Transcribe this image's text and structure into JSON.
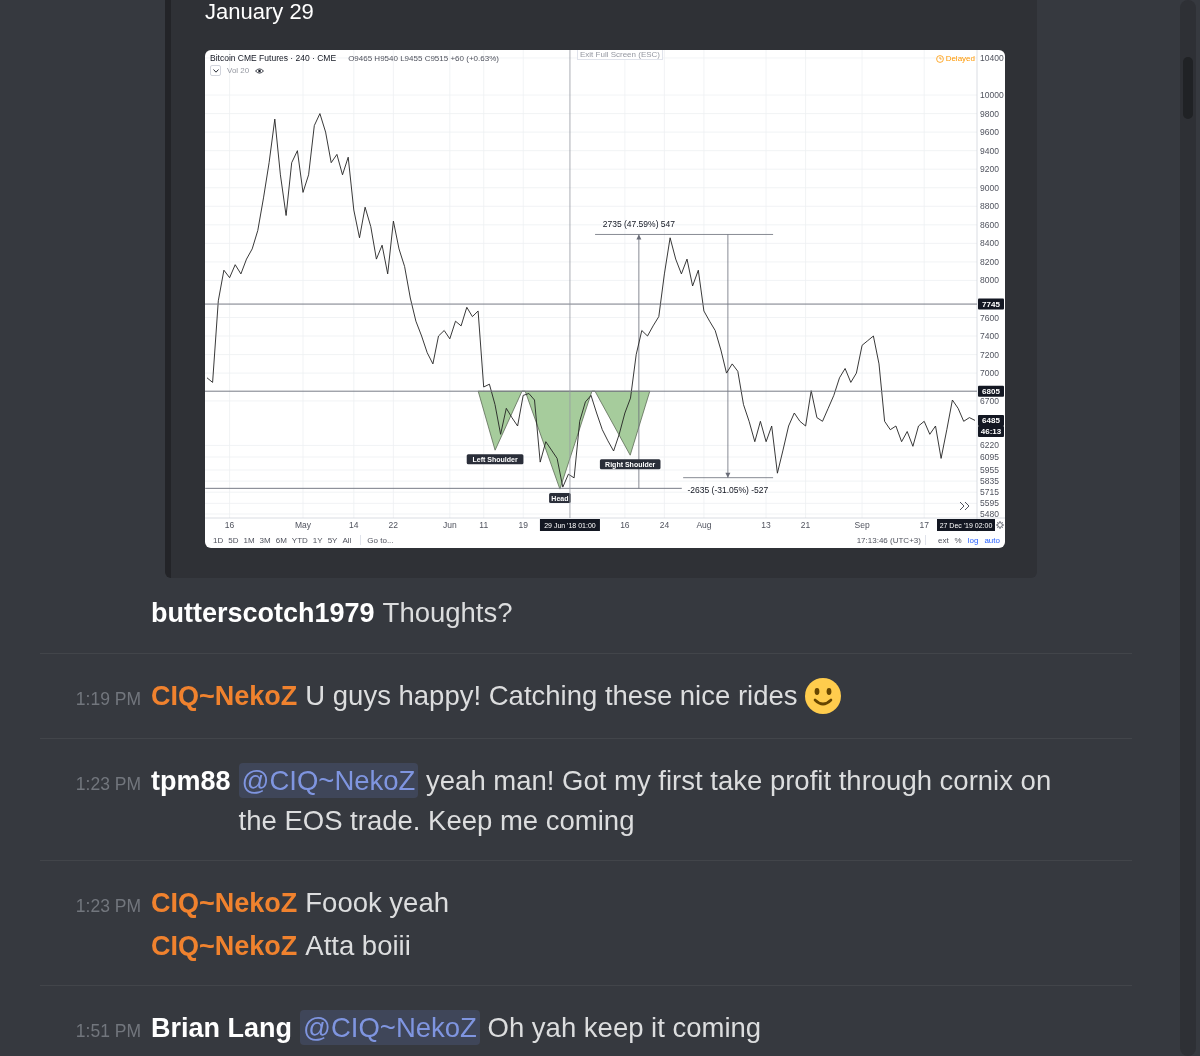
{
  "embed": {
    "title": "January 29",
    "image": {
      "ohlc": "O9465 H9540 L9455 C9515 +60 (+0.63%)",
      "indicator": "Vol 20",
      "exit_hint": "Exit Full Screen (ESC)",
      "status": "Delayed",
      "chart_data": {
        "type": "line",
        "title": "Bitcoin CME Futures · 240 · CME",
        "grid": true,
        "ylim": [
          5437,
          10486
        ],
        "categories": [
          null,
          null,
          null,
          null,
          "16",
          null,
          null,
          null,
          null,
          null,
          null,
          null,
          null,
          null,
          null,
          null,
          null,
          "May",
          null,
          null,
          null,
          null,
          null,
          null,
          null,
          null,
          "14",
          null,
          null,
          null,
          null,
          null,
          null,
          "22",
          null,
          null,
          null,
          null,
          null,
          null,
          null,
          null,
          null,
          "Jun",
          null,
          null,
          null,
          null,
          null,
          "11",
          null,
          null,
          null,
          null,
          null,
          null,
          "19",
          null,
          null,
          null,
          null,
          null,
          null,
          null,
          null,
          null,
          null,
          null,
          null,
          null,
          null,
          null,
          null,
          null,
          "16",
          null,
          null,
          null,
          null,
          null,
          null,
          "24",
          null,
          null,
          null,
          null,
          null,
          null,
          "Aug",
          null,
          null,
          null,
          null,
          null,
          null,
          null,
          null,
          null,
          null,
          "13",
          null,
          null,
          null,
          null,
          null,
          null,
          "21",
          null,
          null,
          null,
          null,
          null,
          null,
          null,
          null,
          null,
          "Sep",
          null,
          null,
          null,
          null,
          null,
          null,
          null,
          null,
          null,
          null,
          "17",
          null,
          null,
          null,
          null,
          null,
          null,
          null,
          null,
          null
        ],
        "yticks": [
          10400,
          10000,
          9800,
          9600,
          9400,
          9200,
          9000,
          8800,
          8600,
          8400,
          8200,
          8000,
          7600,
          7400,
          7200,
          7000,
          6700,
          6220,
          6095,
          5955,
          5835,
          5715,
          5595,
          5480
        ],
        "values": [
          6950,
          6900,
          7780,
          8110,
          8030,
          8170,
          8070,
          8230,
          8340,
          8540,
          8890,
          9270,
          9740,
          9140,
          8700,
          9270,
          9400,
          8950,
          9140,
          9670,
          9800,
          9600,
          9270,
          9360,
          9140,
          9330,
          8760,
          8460,
          8790,
          8580,
          8230,
          8380,
          8070,
          8640,
          8340,
          8150,
          7810,
          7560,
          7400,
          7220,
          7100,
          7400,
          7460,
          7370,
          7560,
          7510,
          7710,
          7610,
          7670,
          6850,
          6880,
          6660,
          6340,
          6620,
          6520,
          6430,
          6760,
          6780,
          6710,
          6040,
          6260,
          6170,
          6080,
          5770,
          5910,
          5870,
          6480,
          6690,
          6760,
          6570,
          6390,
          6270,
          6160,
          6340,
          6570,
          6730,
          7200,
          7460,
          7400,
          7510,
          7610,
          8070,
          8460,
          8230,
          8070,
          8230,
          7940,
          8110,
          7670,
          7560,
          7460,
          7250,
          7000,
          7100,
          7020,
          6660,
          6480,
          6260,
          6480,
          6260,
          6430,
          5920,
          6170,
          6430,
          6570,
          6480,
          6430,
          6810,
          6520,
          6480,
          6620,
          6760,
          6950,
          7050,
          6900,
          7000,
          7300,
          7350,
          7400,
          7100,
          6480,
          6390,
          6430,
          6260,
          6370,
          6210,
          6430,
          6480,
          6340,
          6430,
          6080,
          6390,
          6710,
          6620,
          6480,
          6520,
          6490
        ],
        "ref_lines": [
          {
            "axis": "y",
            "value": 7745,
            "label": "7745"
          },
          {
            "axis": "y",
            "value": 6805,
            "label": "6805"
          }
        ],
        "annotations": [
          "Left Shoulder",
          "Head",
          "Right Shoulder",
          "2735 (47.59%) 547",
          "-2635 (-31.05%) -527",
          "6485",
          "46:13",
          "29 Jun '18 01:00",
          "27 Dec '19 02:00"
        ]
      },
      "ranges": [
        {
          "label": "1D",
          "selected": false
        },
        {
          "label": "5D",
          "selected": false
        },
        {
          "label": "1M",
          "selected": false
        },
        {
          "label": "3M",
          "selected": false
        },
        {
          "label": "6M",
          "selected": false
        },
        {
          "label": "YTD",
          "selected": false
        },
        {
          "label": "1Y",
          "selected": false
        },
        {
          "label": "5Y",
          "selected": false
        },
        {
          "label": "All",
          "selected": false
        }
      ],
      "goto": "Go to...",
      "clock": "17:13:46 (UTC+3)",
      "scale_options": [
        {
          "label": "ext",
          "on": false
        },
        {
          "label": "%",
          "on": false
        },
        {
          "label": "log",
          "on": true
        },
        {
          "label": "auto",
          "on": true
        }
      ]
    }
  },
  "messages": [
    {
      "lines": [
        {
          "author": {
            "name": "butterscotch1979",
            "color": "#ffffff"
          },
          "parts": [
            {
              "kind": "text",
              "text": "Thoughts?"
            }
          ]
        }
      ]
    },
    {
      "time": "1:19 PM",
      "lines": [
        {
          "author": {
            "name": "CIQ~NekoZ",
            "color": "#f0822e"
          },
          "parts": [
            {
              "kind": "text",
              "text": "U guys happy! Catching these nice rides"
            },
            {
              "kind": "emoji"
            }
          ]
        }
      ]
    },
    {
      "time": "1:23 PM",
      "lines": [
        {
          "author": {
            "name": "tpm88",
            "color": "#ffffff"
          },
          "parts": [
            {
              "kind": "mention",
              "text": "@CIQ~NekoZ"
            },
            {
              "kind": "text",
              "text": "yeah man! Got my first take profit through cornix on the EOS trade. Keep me coming"
            }
          ]
        }
      ]
    },
    {
      "time": "1:23 PM",
      "lines": [
        {
          "author": {
            "name": "CIQ~NekoZ",
            "color": "#f0822e"
          },
          "parts": [
            {
              "kind": "text",
              "text": "Foook yeah"
            }
          ]
        },
        {
          "author": {
            "name": "CIQ~NekoZ",
            "color": "#f0822e"
          },
          "parts": [
            {
              "kind": "text",
              "text": "Atta boiii"
            }
          ]
        }
      ]
    },
    {
      "time": "1:51 PM",
      "lines": [
        {
          "author": {
            "name": "Brian Lang",
            "color": "#ffffff"
          },
          "parts": [
            {
              "kind": "mention",
              "text": "@CIQ~NekoZ"
            },
            {
              "kind": "text",
              "text": "Oh yah keep it coming"
            }
          ]
        }
      ]
    }
  ]
}
